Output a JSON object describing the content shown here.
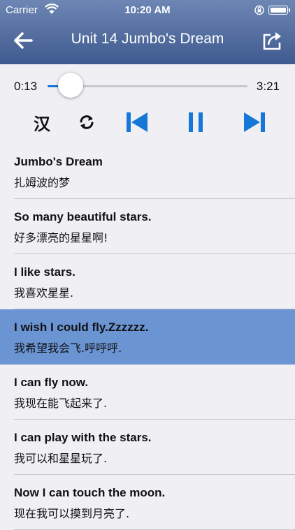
{
  "status_bar": {
    "carrier": "Carrier",
    "time": "10:20 AM",
    "icons": [
      "wifi-icon",
      "orientation-lock-icon",
      "battery-icon"
    ]
  },
  "nav": {
    "title": "Unit 14 Jumbo's Dream",
    "back_icon": "arrow-left-icon",
    "share_icon": "share-icon"
  },
  "player": {
    "current_time": "0:13",
    "total_time": "3:21",
    "progress": 0.067,
    "toggle_chinese_label": "汉",
    "controls": [
      "loop-icon",
      "previous-icon",
      "pause-icon",
      "next-icon"
    ],
    "accent_color": "#1578d6"
  },
  "sentences": [
    {
      "en": "Jumbo's Dream",
      "zh": "扎姆波的梦",
      "active": false
    },
    {
      "en": "So many beautiful stars.",
      "zh": "好多漂亮的星星啊!",
      "active": false
    },
    {
      "en": "I like stars.",
      "zh": "我喜欢星星.",
      "active": false
    },
    {
      "en": "I wish I could fly.Zzzzzz.",
      "zh": "我希望我会飞.呼呼呼.",
      "active": true
    },
    {
      "en": "I can fly now.",
      "zh": "我现在能飞起来了.",
      "active": false
    },
    {
      "en": "I can play with the stars.",
      "zh": "我可以和星星玩了.",
      "active": false
    },
    {
      "en": "Now I can touch the moon.",
      "zh": "现在我可以摸到月亮了.",
      "active": false
    }
  ],
  "colors": {
    "header_top": "#6d86b4",
    "header_bottom": "#3f5a8f",
    "highlight_row": "#6a94d2"
  }
}
